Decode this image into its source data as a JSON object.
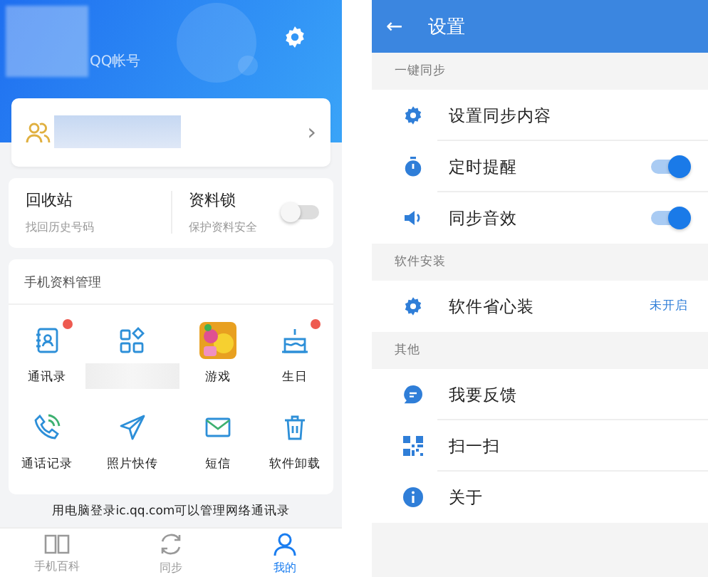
{
  "left_screen": {
    "header": {
      "account_label": "QQ帐号"
    },
    "account_card": {
      "chevron": "›"
    },
    "quick_cards": [
      {
        "title": "回收站",
        "subtitle": "找回历史号码",
        "kind": "link"
      },
      {
        "title": "资料锁",
        "subtitle": "保护资料安全",
        "kind": "toggle",
        "on": false
      }
    ],
    "manage_panel": {
      "title": "手机资料管理",
      "items": [
        {
          "label": "通讯录",
          "badge": true
        },
        {
          "badge": false
        },
        {
          "label": "游戏",
          "badge": false
        },
        {
          "label": "生日",
          "badge": true
        },
        {
          "label": "通话记录",
          "badge": false
        },
        {
          "label": "照片快传",
          "badge": false
        },
        {
          "label": "短信",
          "badge": false
        },
        {
          "label": "软件卸载",
          "badge": false
        }
      ]
    },
    "footer_note": "用电脑登录ic.qq.com可以管理网络通讯录",
    "tabs": [
      {
        "label": "手机百科",
        "selected": false
      },
      {
        "label": "同步",
        "selected": false
      },
      {
        "label": "我的",
        "selected": true
      }
    ]
  },
  "right_screen": {
    "title": "设置",
    "back": "←",
    "sections": [
      {
        "header": "一键同步",
        "rows": [
          {
            "label": "设置同步内容",
            "kind": "plain"
          },
          {
            "label": "定时提醒",
            "kind": "toggle",
            "on": true
          },
          {
            "label": "同步音效",
            "kind": "toggle",
            "on": true
          }
        ]
      },
      {
        "header": "软件安装",
        "rows": [
          {
            "label": "软件省心装",
            "kind": "status",
            "status": "未开启"
          }
        ]
      },
      {
        "header": "其他",
        "rows": [
          {
            "label": "我要反馈",
            "kind": "plain"
          },
          {
            "label": "扫一扫",
            "kind": "plain"
          },
          {
            "label": "关于",
            "kind": "plain"
          }
        ]
      }
    ]
  }
}
